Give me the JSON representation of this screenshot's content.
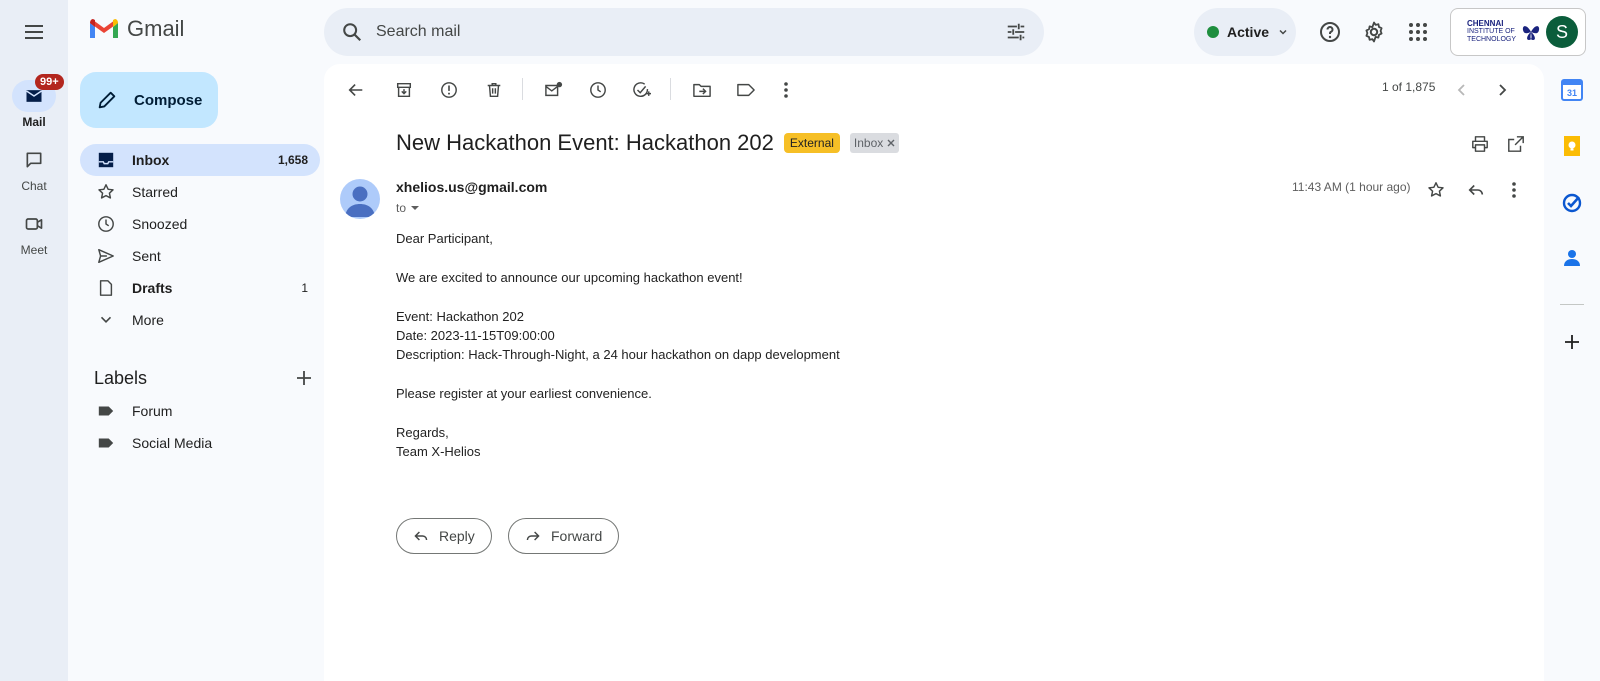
{
  "app": {
    "name": "Gmail"
  },
  "rail": {
    "items": [
      {
        "label": "Mail",
        "badge": "99+"
      },
      {
        "label": "Chat"
      },
      {
        "label": "Meet"
      }
    ]
  },
  "search": {
    "placeholder": "Search mail"
  },
  "status": {
    "label": "Active",
    "color": "#1e8e3e"
  },
  "account": {
    "org_line1": "CHENNAI",
    "org_line2": "INSTITUTE OF",
    "org_line3": "TECHNOLOGY",
    "avatar_letter": "S",
    "avatar_color": "#0b5d3b"
  },
  "sidebar": {
    "compose_label": "Compose",
    "items": [
      {
        "label": "Inbox",
        "count": "1,658"
      },
      {
        "label": "Starred",
        "count": ""
      },
      {
        "label": "Snoozed",
        "count": ""
      },
      {
        "label": "Sent",
        "count": ""
      },
      {
        "label": "Drafts",
        "count": "1"
      },
      {
        "label": "More",
        "count": ""
      }
    ],
    "labels_title": "Labels",
    "labels": [
      {
        "label": "Forum"
      },
      {
        "label": "Social Media"
      }
    ]
  },
  "toolbar": {
    "pager": "1 of 1,875"
  },
  "message": {
    "subject": "New Hackathon Event: Hackathon 202",
    "tags": {
      "external": "External",
      "inbox": "Inbox"
    },
    "sender": "xhelios.us@gmail.com",
    "to": "to",
    "time": "11:43 AM (1 hour ago)",
    "body": {
      "greeting": "Dear Participant,",
      "intro": "We are excited to announce our upcoming hackathon event!",
      "event": "Event: Hackathon 202",
      "date": "Date: 2023-11-15T09:00:00",
      "description": "Description: Hack-Through-Night, a 24 hour hackathon on dapp development",
      "register": "Please register at your earliest convenience.",
      "regards": "Regards,",
      "signature": "Team X-Helios"
    },
    "actions": {
      "reply": "Reply",
      "forward": "Forward"
    }
  },
  "side_panel": {
    "calendar_day": "31"
  }
}
